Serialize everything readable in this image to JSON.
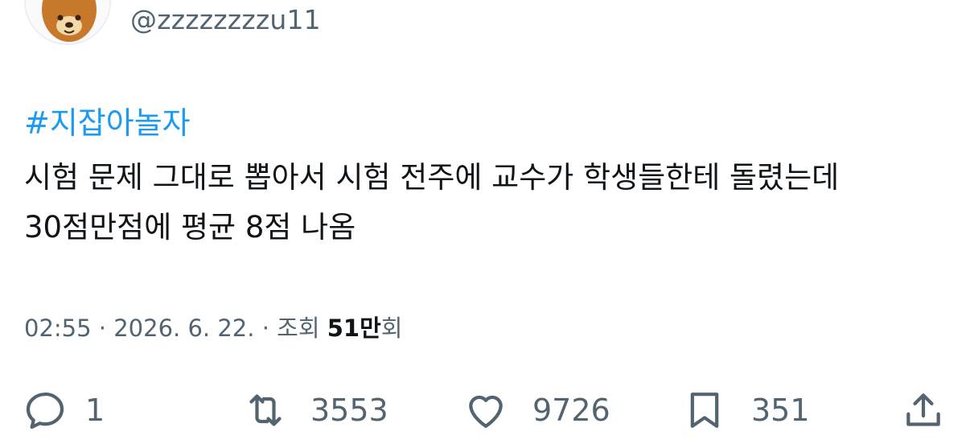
{
  "tweet": {
    "handle": "@zzzzzzzzu11",
    "hashtag": "#지잡아놀자",
    "text_lines": [
      "시험 문제 그대로 뽑아서 시험 전주에 교수가 학생들한테 돌렸는데",
      "30점만점에 평균 8점 나옴"
    ],
    "meta": {
      "time_date": "02:55 · 2026. 6. 22. · ",
      "views_label": "조회",
      "views_count": "51만",
      "views_suffix": "회"
    },
    "actions": {
      "reply": {
        "icon": "reply-icon",
        "count": "1"
      },
      "retweet": {
        "icon": "retweet-icon",
        "count": "3553"
      },
      "like": {
        "icon": "heart-icon",
        "count": "9726"
      },
      "bookmark": {
        "icon": "bookmark-icon",
        "count": "351"
      },
      "share": {
        "icon": "share-icon"
      }
    }
  },
  "colors": {
    "hashtag": "#1d9bf0",
    "secondary_text": "#536471",
    "primary_text": "#0f1419",
    "avatar_bear": "#c8782a"
  }
}
